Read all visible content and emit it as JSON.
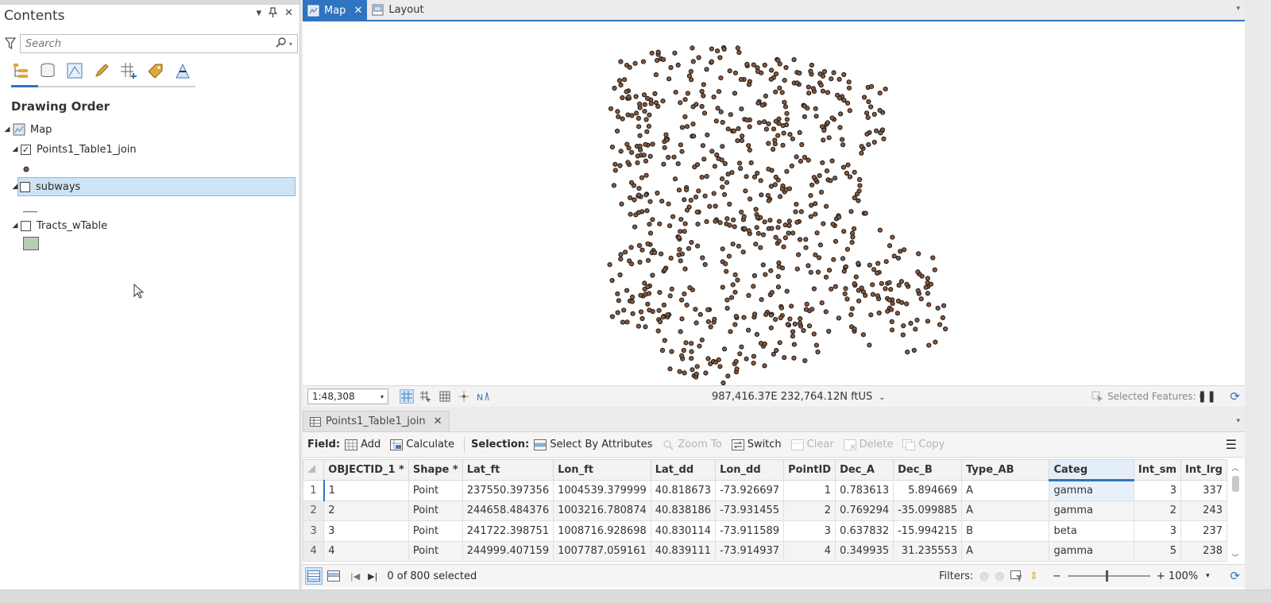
{
  "contents": {
    "title": "Contents",
    "search_placeholder": "Search",
    "section_heading": "Drawing Order",
    "layers": [
      {
        "label": "Map",
        "checked": null
      },
      {
        "label": "Points1_Table1_join",
        "checked": true
      },
      {
        "label": "subways",
        "checked": false,
        "selected": true
      },
      {
        "label": "Tracts_wTable",
        "checked": false
      }
    ],
    "colors": {
      "point_fill": "#8b5a3c",
      "line": "#b07a4e",
      "polygon_fill": "#b9ccb4",
      "accent": "#2f74c0"
    }
  },
  "map": {
    "tabs": [
      {
        "label": "Map",
        "active": true,
        "icon": "map-icon"
      },
      {
        "label": "Layout",
        "active": false,
        "icon": "layout-icon"
      }
    ],
    "scale": "1:48,308",
    "coordinates": "987,416.37E 232,764.12N ftUS",
    "selected_features": "Selected Features: 0"
  },
  "table": {
    "tab_label": "Points1_Table1_join",
    "toolbar": {
      "field_label": "Field:",
      "add": "Add",
      "calculate": "Calculate",
      "selection_label": "Selection:",
      "select_by_attributes": "Select By Attributes",
      "zoom_to": "Zoom To",
      "switch": "Switch",
      "clear": "Clear",
      "delete": "Delete",
      "copy": "Copy"
    },
    "columns": [
      "OBJECTID_1 *",
      "Shape *",
      "Lat_ft",
      "Lon_ft",
      "Lat_dd",
      "Lon_dd",
      "PointID",
      "Dec_A",
      "Dec_B",
      "Type_AB",
      "Categ",
      "Int_sm",
      "Int_lrg"
    ],
    "rows": [
      {
        "n": "1",
        "cells": [
          "1",
          "Point",
          "237550.397356",
          "1004539.379999",
          "40.818673",
          "-73.926697",
          "1",
          "0.783613",
          "5.894669",
          "A",
          "gamma",
          "3",
          "337"
        ]
      },
      {
        "n": "2",
        "cells": [
          "2",
          "Point",
          "244658.484376",
          "1003216.780874",
          "40.838186",
          "-73.931455",
          "2",
          "0.769294",
          "-35.099885",
          "A",
          "gamma",
          "2",
          "243"
        ]
      },
      {
        "n": "3",
        "cells": [
          "3",
          "Point",
          "241722.398751",
          "1008716.928698",
          "40.830114",
          "-73.911589",
          "3",
          "0.637832",
          "-15.994215",
          "B",
          "beta",
          "3",
          "237"
        ]
      },
      {
        "n": "4",
        "cells": [
          "4",
          "Point",
          "244999.407159",
          "1007787.059161",
          "40.839111",
          "-73.914937",
          "4",
          "0.349935",
          "31.235553",
          "A",
          "gamma",
          "5",
          "238"
        ]
      }
    ],
    "selection_count": "0 of 800 selected",
    "filters_label": "Filters:",
    "zoom": "100%"
  }
}
